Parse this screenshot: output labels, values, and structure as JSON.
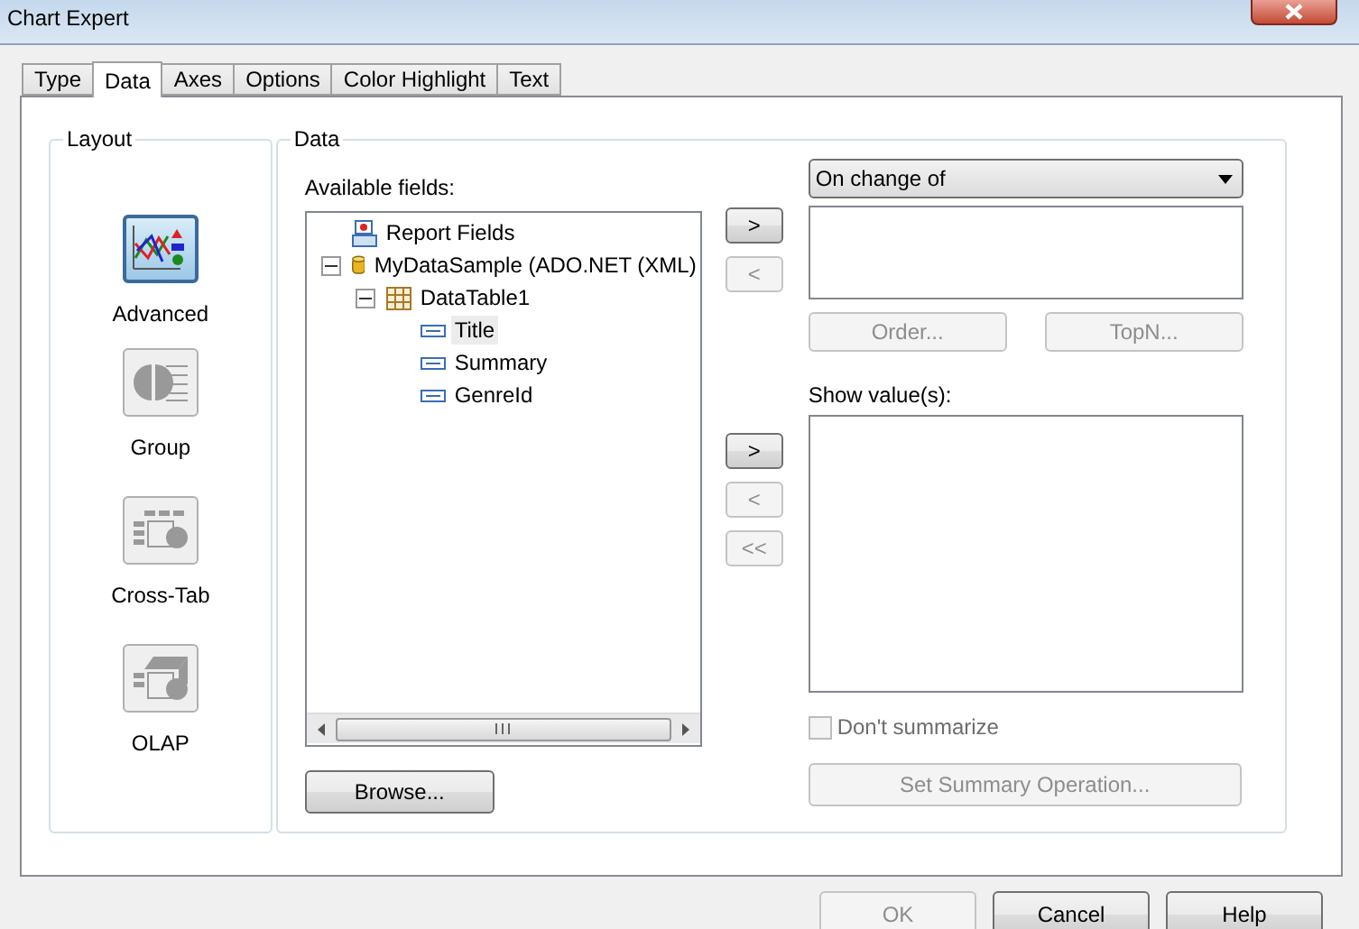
{
  "window": {
    "title": "Chart Expert"
  },
  "tabs": [
    {
      "label": "Type",
      "selected": false
    },
    {
      "label": "Data",
      "selected": true
    },
    {
      "label": "Axes",
      "selected": false
    },
    {
      "label": "Options",
      "selected": false
    },
    {
      "label": "Color Highlight",
      "selected": false
    },
    {
      "label": "Text",
      "selected": false
    }
  ],
  "layout": {
    "title": "Layout",
    "items": [
      {
        "kind": "advanced",
        "label": "Advanced",
        "selected": true
      },
      {
        "kind": "group",
        "label": "Group",
        "selected": false
      },
      {
        "kind": "crosstab",
        "label": "Cross-Tab",
        "selected": false
      },
      {
        "kind": "olap",
        "label": "OLAP",
        "selected": false
      }
    ]
  },
  "data": {
    "title": "Data",
    "available_label": "Available fields:",
    "tree": [
      {
        "kind": "report",
        "label": "Report Fields",
        "selected": false
      },
      {
        "kind": "database",
        "label": "MyDataSample (ADO.NET (XML)",
        "selected": false,
        "expanded": true,
        "children": [
          {
            "kind": "table",
            "label": "DataTable1",
            "selected": false,
            "expanded": true,
            "children": [
              {
                "kind": "field",
                "label": "Title",
                "selected": true
              },
              {
                "kind": "field",
                "label": "Summary",
                "selected": false
              },
              {
                "kind": "field",
                "label": "GenreId",
                "selected": false
              }
            ]
          }
        ]
      }
    ],
    "browse_button": "Browse...",
    "group_arrows": [
      {
        "label": ">",
        "disabled": false
      },
      {
        "label": "<",
        "disabled": true
      }
    ],
    "value_arrows": [
      {
        "label": ">",
        "disabled": false
      },
      {
        "label": "<",
        "disabled": true
      },
      {
        "label": "<<",
        "disabled": true
      }
    ],
    "group_by": {
      "value": "On change of"
    },
    "order_button": {
      "label": "Order...",
      "disabled": true
    },
    "topn_button": {
      "label": "TopN...",
      "disabled": true
    },
    "show_values_label": "Show value(s):",
    "dont_summarize": {
      "label": "Don't summarize",
      "checked": false,
      "disabled": true
    },
    "summary_button": {
      "label": "Set Summary Operation...",
      "disabled": true
    }
  },
  "footer": [
    {
      "label": "OK",
      "disabled": true
    },
    {
      "label": "Cancel",
      "disabled": false
    },
    {
      "label": "Help",
      "disabled": false
    }
  ]
}
